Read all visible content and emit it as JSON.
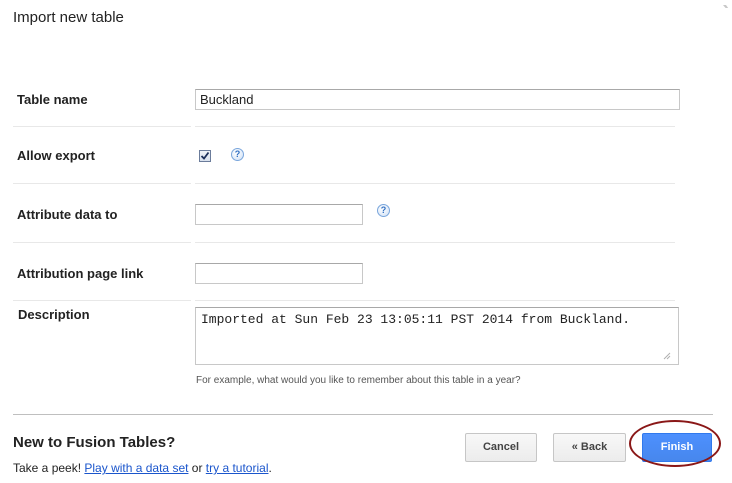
{
  "dialog": {
    "title": "Import new table"
  },
  "form": {
    "table_name": {
      "label": "Table name",
      "value": "Buckland"
    },
    "allow_export": {
      "label": "Allow export",
      "checked": true,
      "help_icon": "question-icon"
    },
    "attribute_data": {
      "label": "Attribute data to",
      "value": "",
      "help_icon": "question-icon"
    },
    "attribution_link": {
      "label": "Attribution page link",
      "value": ""
    },
    "description": {
      "label": "Description",
      "value": "Imported at Sun Feb 23 13:05:11 PST 2014 from Buckland.",
      "hint": "For example, what would you like to remember about this table in a year?"
    }
  },
  "promo": {
    "heading": "New to Fusion Tables?",
    "prefix": "Take a peek! ",
    "link1": "Play with a data set",
    "middle": " or ",
    "link2": "try a tutorial",
    "suffix": "."
  },
  "buttons": {
    "cancel": "Cancel",
    "back": "« Back",
    "finish": "Finish"
  },
  "colors": {
    "primary_button": "#4d90fe",
    "link": "#1a55cc",
    "highlight_oval": "#8a1717"
  }
}
